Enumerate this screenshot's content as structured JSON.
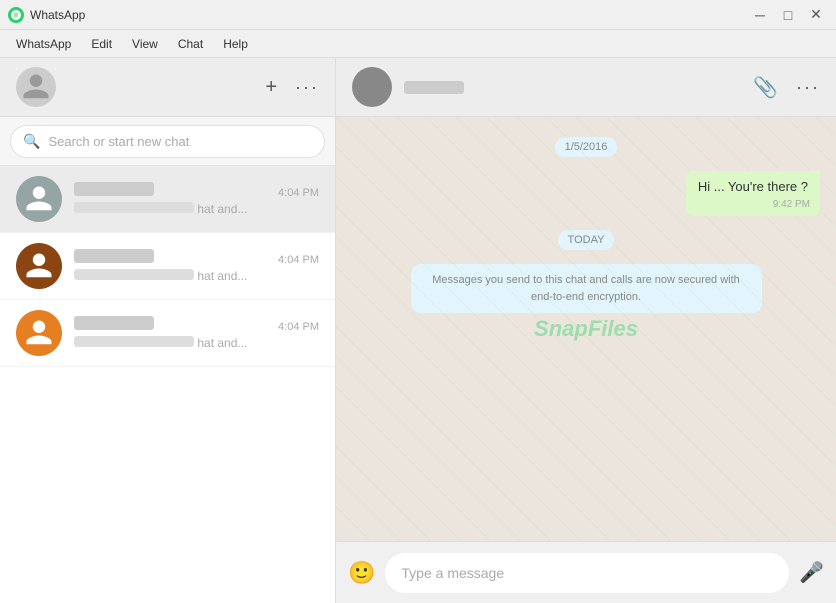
{
  "titlebar": {
    "title": "WhatsApp",
    "min_label": "─",
    "max_label": "□",
    "close_label": "✕"
  },
  "menubar": {
    "items": [
      "WhatsApp",
      "Edit",
      "View",
      "Chat",
      "Help"
    ]
  },
  "sidebar": {
    "search_placeholder": "Search or start new chat",
    "chats": [
      {
        "name_hidden": true,
        "time": "4:04 PM",
        "preview": "hat and...",
        "avatar_color": "gray"
      },
      {
        "name_hidden": true,
        "time": "4:04 PM",
        "preview": "hat and...",
        "avatar_color": "red"
      },
      {
        "name_hidden": true,
        "time": "4:04 PM",
        "preview": "hat and...",
        "avatar_color": "orange"
      }
    ]
  },
  "chat": {
    "contact_name_hidden": true,
    "messages": [
      {
        "type": "date",
        "text": "1/5/2016"
      },
      {
        "type": "sent",
        "text": "Hi ... You're there ?",
        "time": "9:42 PM"
      },
      {
        "type": "date",
        "text": "TODAY"
      },
      {
        "type": "system",
        "text": "Messages you send to this chat and calls are now secured with end-to-end encryption."
      }
    ]
  },
  "input": {
    "placeholder": "Type a message"
  },
  "watermark": "SnapFiles"
}
